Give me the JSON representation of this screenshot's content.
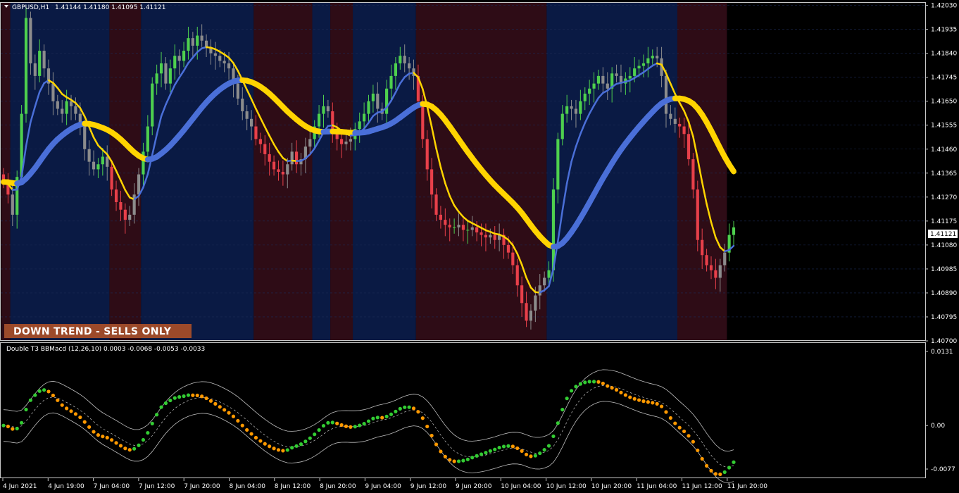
{
  "chart_info": {
    "label": "GBPUSD,H1",
    "ohlc": "1.41144 1.41180 1.41095 1.41121"
  },
  "indicator": {
    "label": "Double T3 BBMacd (12,26,10) 0.0003 -0.0068 -0.0053 -0.0033",
    "y_ticks": [
      "0.0131",
      "0.00",
      "-0.0077"
    ],
    "y_values": [
      0.0131,
      0.0,
      -0.0077
    ]
  },
  "trend_badge": {
    "text": "DOWN TREND - SELLS ONLY",
    "color": "#9c4a2a"
  },
  "price_axis": {
    "ticks": [
      "1.42030",
      "1.41935",
      "1.41840",
      "1.41745",
      "1.41650",
      "1.41555",
      "1.41460",
      "1.41365",
      "1.41270",
      "1.41175",
      "1.41080",
      "1.40985",
      "1.40890",
      "1.40795",
      "1.40700"
    ],
    "current": "1.41121"
  },
  "time_axis": {
    "labels": [
      "4 Jun 2021",
      "4 Jun 19:00",
      "7 Jun 04:00",
      "7 Jun 12:00",
      "7 Jun 20:00",
      "8 Jun 04:00",
      "8 Jun 12:00",
      "8 Jun 20:00",
      "9 Jun 04:00",
      "9 Jun 12:00",
      "9 Jun 20:00",
      "10 Jun 04:00",
      "10 Jun 12:00",
      "10 Jun 20:00",
      "11 Jun 04:00",
      "11 Jun 12:00",
      "11 Jun 20:00"
    ]
  },
  "colors": {
    "bull": "#4ed04e",
    "bear": "#e8404a",
    "neutral": "#8c8c8c",
    "bg_up": "#0a1a44",
    "bg_down": "#2e0c16",
    "t3_fast_up": "#4a6fd8",
    "t3_fast_down": "#ffd400",
    "dot_up": "#33cc33",
    "dot_down": "#ff9900"
  },
  "chart_data": {
    "type": "candlestick",
    "symbol": "GBPUSD",
    "timeframe": "H1",
    "ylim": [
      1.407,
      1.4204
    ],
    "trend_zones": [
      {
        "from": 0,
        "to": 2,
        "trend": "down"
      },
      {
        "from": 2,
        "to": 24,
        "trend": "up"
      },
      {
        "from": 24,
        "to": 31,
        "trend": "down"
      },
      {
        "from": 31,
        "to": 56,
        "trend": "up"
      },
      {
        "from": 56,
        "to": 69,
        "trend": "down"
      },
      {
        "from": 69,
        "to": 73,
        "trend": "up"
      },
      {
        "from": 73,
        "to": 78,
        "trend": "down"
      },
      {
        "from": 78,
        "to": 92,
        "trend": "up"
      },
      {
        "from": 92,
        "to": 121,
        "trend": "down"
      },
      {
        "from": 121,
        "to": 150,
        "trend": "up"
      },
      {
        "from": 150,
        "to": 161,
        "trend": "down"
      }
    ],
    "closes": [
      1.4133,
      1.4128,
      1.412,
      1.4135,
      1.416,
      1.4198,
      1.418,
      1.4175,
      1.4185,
      1.4178,
      1.4172,
      1.4165,
      1.4162,
      1.416,
      1.4165,
      1.4163,
      1.416,
      1.4155,
      1.4146,
      1.4141,
      1.4138,
      1.414,
      1.4143,
      1.4139,
      1.413,
      1.4125,
      1.4122,
      1.4118,
      1.412,
      1.4128,
      1.4136,
      1.4145,
      1.4155,
      1.4172,
      1.4176,
      1.418,
      1.4172,
      1.4178,
      1.4183,
      1.4181,
      1.4185,
      1.419,
      1.4187,
      1.4191,
      1.4189,
      1.4186,
      1.4184,
      1.4183,
      1.4181,
      1.418,
      1.4178,
      1.4172,
      1.4166,
      1.4161,
      1.4158,
      1.4155,
      1.415,
      1.4148,
      1.4144,
      1.4141,
      1.4138,
      1.4137,
      1.4136,
      1.414,
      1.4145,
      1.414,
      1.4142,
      1.4147,
      1.415,
      1.4155,
      1.416,
      1.4163,
      1.4161,
      1.4152,
      1.415,
      1.4148,
      1.4149,
      1.415,
      1.4154,
      1.4157,
      1.416,
      1.4165,
      1.4168,
      1.4162,
      1.416,
      1.417,
      1.4175,
      1.418,
      1.4183,
      1.418,
      1.4178,
      1.4175,
      1.4165,
      1.415,
      1.4138,
      1.4128,
      1.412,
      1.4118,
      1.4116,
      1.4115,
      1.4115,
      1.4116,
      1.4114,
      1.4114,
      1.4115,
      1.4113,
      1.4112,
      1.4111,
      1.4112,
      1.411,
      1.4112,
      1.4108,
      1.4105,
      1.41,
      1.4092,
      1.4085,
      1.4078,
      1.4082,
      1.4088,
      1.4092,
      1.4095,
      1.4098,
      1.413,
      1.415,
      1.416,
      1.4163,
      1.4162,
      1.416,
      1.4165,
      1.4168,
      1.417,
      1.4172,
      1.4175,
      1.4172,
      1.417,
      1.4176,
      1.4175,
      1.4172,
      1.4174,
      1.4175,
      1.4178,
      1.4179,
      1.418,
      1.4182,
      1.4183,
      1.4182,
      1.4175,
      1.416,
      1.4158,
      1.4156,
      1.4155,
      1.4152,
      1.4142,
      1.413,
      1.411,
      1.4104,
      1.41,
      1.4098,
      1.4095,
      1.41,
      1.4105,
      1.4112,
      1.4115
    ]
  }
}
